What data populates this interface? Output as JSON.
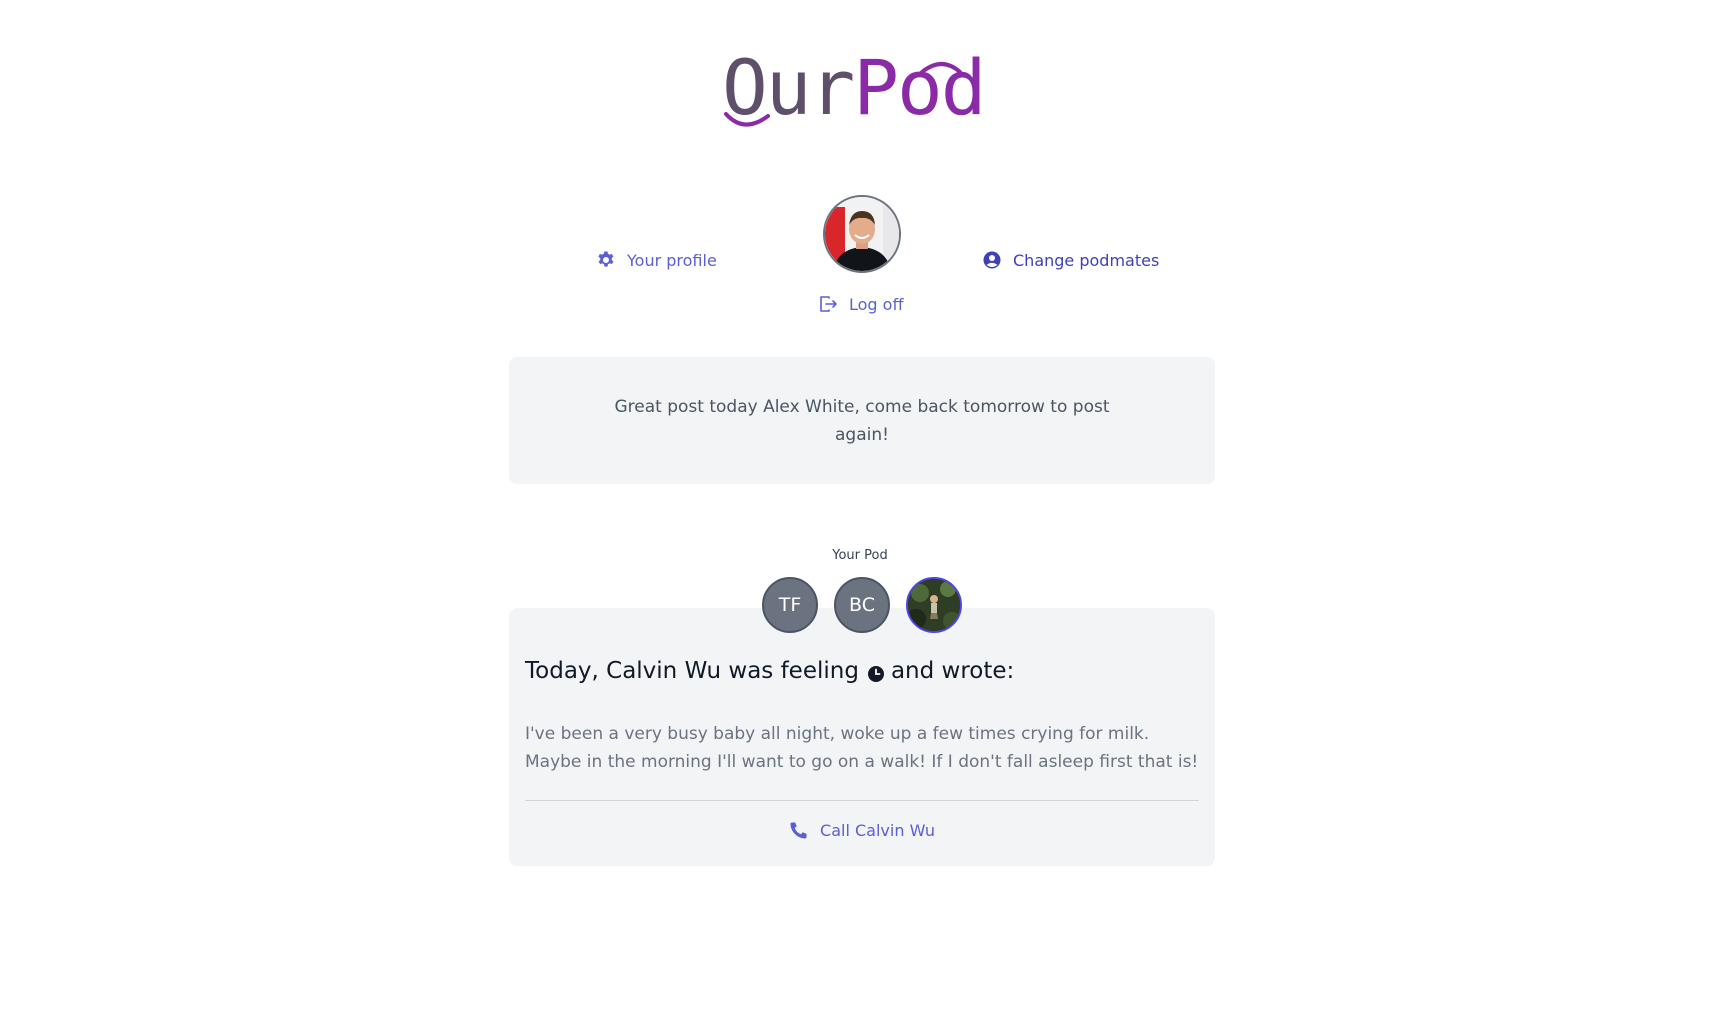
{
  "logo": {
    "part1": "Our",
    "part2": "Pod",
    "colors": {
      "our": "#5e4f6a",
      "pod": "#8b2aa6"
    }
  },
  "nav": {
    "profile": {
      "label": "Your profile",
      "icon": "gear-icon"
    },
    "podmates": {
      "label": "Change podmates",
      "icon": "user-circle-icon"
    },
    "logoff": {
      "label": "Log off",
      "icon": "logout-icon"
    }
  },
  "notice": {
    "text": "Great post today Alex White, come back tomorrow to post again!"
  },
  "pod": {
    "title": "Your Pod",
    "members": [
      {
        "initials": "TF"
      },
      {
        "initials": "BC"
      },
      {
        "initials": "",
        "photo": true,
        "selected": true
      }
    ],
    "post": {
      "heading_before": "Today, Calvin Wu was feeling",
      "heading_after": "and wrote:",
      "mood_icon": "clock-icon",
      "body": "I've been a very busy baby all night, woke up a few times crying for milk. Maybe in the morning I'll want to go on a walk! If I don't fall asleep first that is!",
      "call_label": "Call Calvin Wu",
      "call_icon": "phone-icon"
    }
  },
  "colors": {
    "accent": "#5a5fd1",
    "card_bg": "#f3f4f6"
  }
}
